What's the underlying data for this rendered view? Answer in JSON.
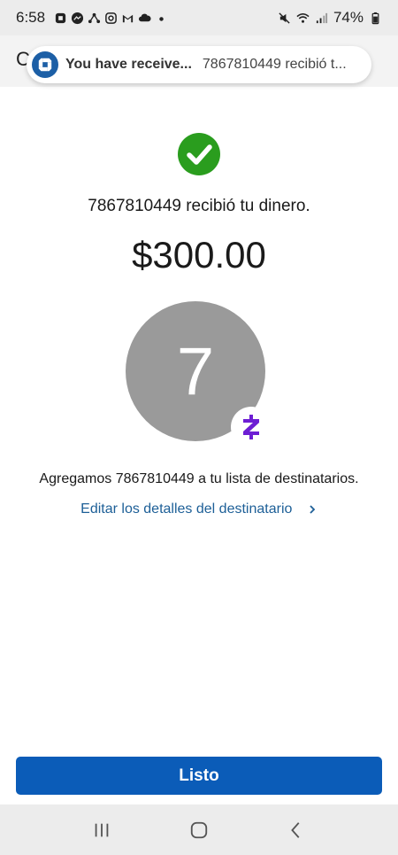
{
  "status_bar": {
    "time": "6:58",
    "battery": "74%",
    "icons": [
      "chase-icon",
      "messenger-icon",
      "share-icon",
      "instagram-icon",
      "gmail-icon",
      "cloud-icon",
      "dot-icon",
      "mute-icon",
      "wifi-icon",
      "signal-icon",
      "battery-icon"
    ]
  },
  "app_header": {
    "letter": "C"
  },
  "notification": {
    "title": "You have receive...",
    "body": "7867810449 recibió t..."
  },
  "confirmation": {
    "message": "7867810449 recibió tu dinero.",
    "amount": "$300.00",
    "avatar_initial": "7",
    "added_text": "Agregamos 7867810449 a tu lista de destinatarios.",
    "edit_link": "Editar los detalles del destinatario"
  },
  "done_button": {
    "label": "Listo"
  },
  "colors": {
    "success": "#2a9d1e",
    "primary": "#0b5cb8",
    "link": "#1d5f97",
    "zelle": "#6d1ed4",
    "avatar": "#9a9a9a"
  }
}
